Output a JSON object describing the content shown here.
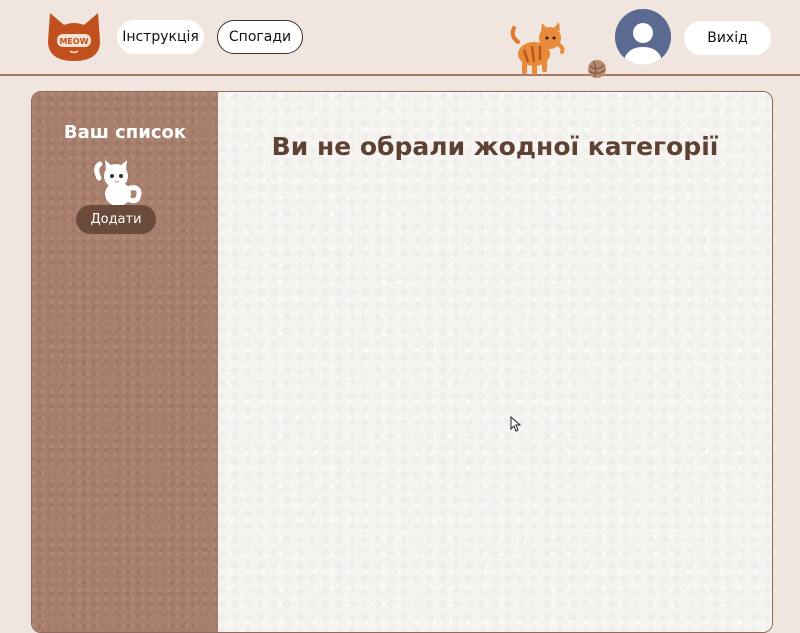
{
  "header": {
    "logo": {
      "icon": "meow-cat-logo-icon",
      "text": "MEOW",
      "color": "#c2501e"
    },
    "nav": {
      "instructions_label": "Інструкція",
      "memories_label": "Спогади"
    },
    "exit_label": "Вихід",
    "avatar": {
      "icon": "user-avatar-icon"
    },
    "decor": {
      "cat_icon": "walking-cat-icon",
      "yarn_icon": "yarn-ball-icon"
    }
  },
  "sidebar": {
    "title": "Ваш список",
    "cat_icon": "waving-cat-icon",
    "add_label": "Додати"
  },
  "main": {
    "empty_message": "Ви не обрали жодної категорії"
  },
  "colors": {
    "background": "#f1e6df",
    "sidebar": "#a77d6b",
    "add_button": "#6b4c3c",
    "heading": "#5e4132",
    "logo": "#c2501e"
  }
}
